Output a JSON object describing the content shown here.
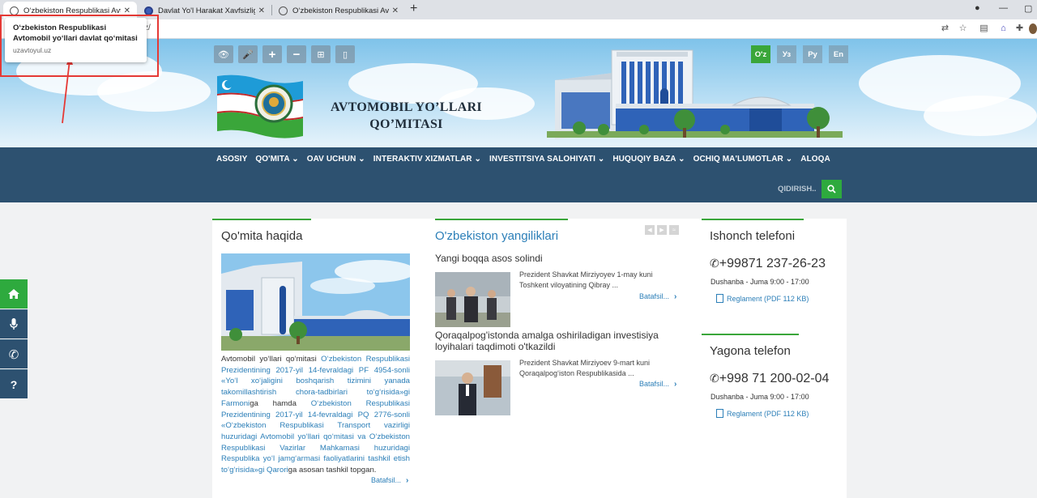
{
  "browser": {
    "tabs": [
      {
        "title": "O‘zbekiston Respublikasi Avtomo",
        "active": true
      },
      {
        "title": "Davlat Yo'l Harakat Xavfsizligi Xiz"
      },
      {
        "title": "O‘zbekiston Respublikasi Avtomo"
      }
    ],
    "url_fragment": "z/",
    "tooltip": {
      "title": "O‘zbekiston Respublikasi Avtomobil yo‘llari davlat qo‘mitasi",
      "url": "uzavtoyul.uz"
    },
    "icons": [
      "translate-icon",
      "star-icon",
      "extension-icon",
      "puzzle-icon",
      "avatar"
    ]
  },
  "header": {
    "site_title_line1": "AVTOMOBIL YO’LLARI",
    "site_title_line2": "QO’MITASI",
    "languages": [
      "O'z",
      "Уз",
      "Ру",
      "En"
    ],
    "active_language": "O'z"
  },
  "nav": {
    "items": [
      "ASOSIY",
      "QO'MITA ⌄",
      "OAV UCHUN ⌄",
      "INTERAKTIV XIZMATLAR ⌄",
      "INVESTITSIYA SALOHIYATI ⌄",
      "HUQUQIY BAZA ⌄",
      "OCHIQ MA'LUMOTLAR ⌄",
      "ALOQA"
    ],
    "search_placeholder": "QIDIRISH.."
  },
  "about": {
    "heading": "Qo'mita haqida",
    "text_plain1": "Avtomobil yo‘llari qo‘mitasi ",
    "text_link1": "O‘zbekiston Respublikasi Prezidentining 2017-yil 14-fevraldagi PF 4954-sonli «Yo‘l xo‘jaligini boshqarish tizimini yanada takomillashtirish chora-tadbirlari to‘g‘risida»gi Farmoni",
    "text_plain2": "ga hamda ",
    "text_link2": "O‘zbekiston Respublikasi Prezidentining 2017-yil 14-fevraldagi PQ 2776-sonli «O‘zbekiston Respublikasi Transport vazirligi huzuridagi Avtomobil yo‘llari qo‘mitasi va O‘zbekiston Respublikasi Vazirlar Mahkamasi huzuridagi Respublika yo‘l jamg‘armasi faoliyatlarini tashkil etish to‘g‘risida»gi Qarori",
    "text_plain3": "ga asosan tashkil topgan.",
    "more": "Batafsil..."
  },
  "news": {
    "heading": "O'zbekiston yangiliklari",
    "items": [
      {
        "title": "Yangi boqqa asos solindi",
        "desc": "Prezident Shavkat Mirziyoyev 1-may kuni Toshkent viloyatining Qibray ...",
        "more": "Batafsil..."
      },
      {
        "title": "Qoraqalpog'istonda amalga oshiriladigan investisiya loyihalari taqdimoti o'tkazildi",
        "desc": "Prezident Shavkat Mirziyoev 9-mart kuni Qoraqalpog‘iston Respublikasida ...",
        "more": "Batafsil..."
      }
    ]
  },
  "contacts": {
    "trust": {
      "heading": "Ishonch telefoni",
      "phone": "+99871 237-26-23",
      "hours": "Dushanba - Juma 9:00 - 17:00",
      "reglament": "Reglament (PDF 112 KB)"
    },
    "single": {
      "heading": "Yagona telefon",
      "phone": "+998 71 200-02-04",
      "hours": "Dushanba - Juma 9:00 - 17:00",
      "reglament": "Reglament (PDF 112 KB)"
    }
  },
  "side_buttons": [
    "home-icon",
    "microphone-icon",
    "phone-icon",
    "question-icon"
  ],
  "colors": {
    "nav": "#2d5170",
    "accent_green": "#3aa63a",
    "link_blue": "#2c7fb8"
  }
}
